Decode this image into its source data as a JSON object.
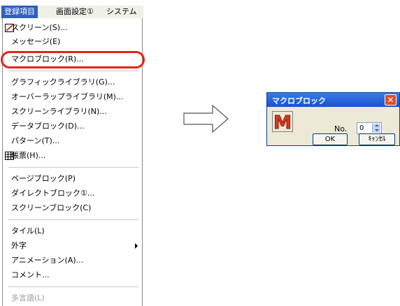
{
  "menubar": {
    "items": [
      {
        "label": "登録項目"
      },
      {
        "label": "画面設定①"
      },
      {
        "label": "システム"
      }
    ]
  },
  "menu": {
    "items": [
      {
        "label": "スクリーン(S)..."
      },
      {
        "label": "メッセージ(E)"
      },
      {
        "label": "マクロブロック(R)..."
      },
      {
        "label": "グラフィックライブラリ(G)..."
      },
      {
        "label": "オーバーラップライブラリ(M)..."
      },
      {
        "label": "スクリーンライブラリ(N)..."
      },
      {
        "label": "データブロック(D)..."
      },
      {
        "label": "パターン(T)..."
      },
      {
        "label": "帳票(H)..."
      },
      {
        "label": "ページブロック(P)"
      },
      {
        "label": "ダイレクトブロック①..."
      },
      {
        "label": "スクリーンブロック(C)"
      },
      {
        "label": "タイル(L)"
      },
      {
        "label": "外字"
      },
      {
        "label": "アニメーション(A)..."
      },
      {
        "label": "コメント..."
      },
      {
        "label": "多言語(L)"
      }
    ]
  },
  "dialog": {
    "title": "マクロブロック",
    "no_label": "No.",
    "no_value": "0",
    "ok_label": "OK",
    "cancel_label": "ｷｬﾝｾﾙ",
    "icon_letter": "M"
  },
  "colors": {
    "highlight_ring": "#e3241b",
    "title_bar": "#1653cf",
    "menu_active": "#2f5fbf"
  }
}
